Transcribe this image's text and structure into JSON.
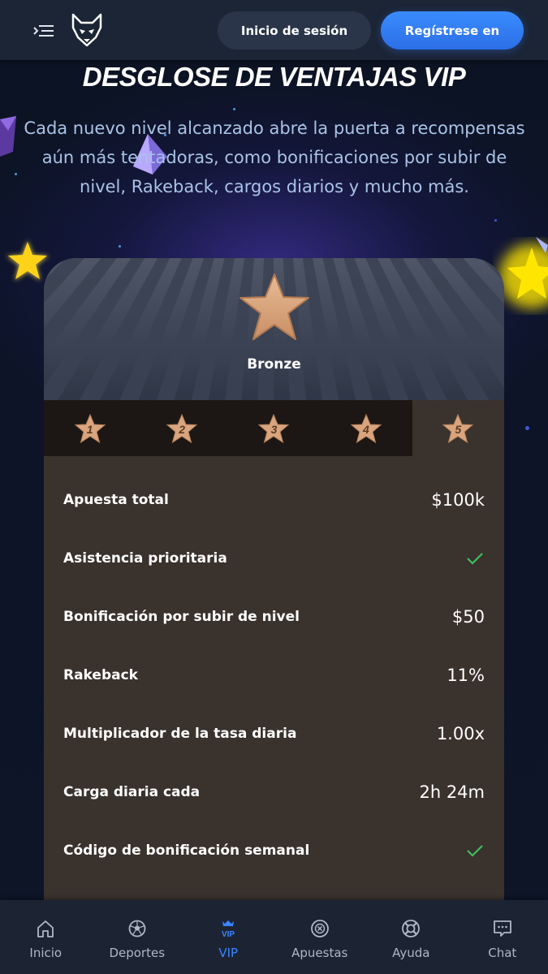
{
  "header": {
    "login_label": "Inicio de sesión",
    "register_label": "Regístrese en"
  },
  "hero": {
    "title": "DESGLOSE DE VENTAJAS VIP",
    "subtitle": "Cada nuevo nivel alcanzado abre la puerta a recompensas aún más tentadoras, como bonificaciones por subir de nivel, Rakeback, cargos diarios y mucho más."
  },
  "card": {
    "tier_name": "Bronze",
    "tier_color": "#d9a47e",
    "levels": [
      "1",
      "2",
      "3",
      "4",
      "5"
    ],
    "selected_level": "5",
    "rows": [
      {
        "label": "Apuesta total",
        "value": "$100k"
      },
      {
        "label": "Asistencia prioritaria",
        "value": "",
        "icon": "check-icon"
      },
      {
        "label": "Bonificación por subir de nivel",
        "value": "$50"
      },
      {
        "label": "Rakeback",
        "value": "11%"
      },
      {
        "label": "Multiplicador de la tasa diaria",
        "value": "1.00x"
      },
      {
        "label": "Carga diaria cada",
        "value": "2h 24m"
      },
      {
        "label": "Código de bonificación semanal",
        "value": "",
        "icon": "check-icon"
      }
    ]
  },
  "bottom_nav": {
    "items": [
      {
        "label": "Inicio",
        "icon": "home-icon"
      },
      {
        "label": "Deportes",
        "icon": "soccer-ball-icon"
      },
      {
        "label": "VIP",
        "icon": "vip-crown-icon",
        "active": true
      },
      {
        "label": "Apuestas",
        "icon": "chip-icon"
      },
      {
        "label": "Ayuda",
        "icon": "lifebuoy-icon"
      },
      {
        "label": "Chat",
        "icon": "chat-icon"
      }
    ]
  },
  "colors": {
    "accent": "#3a86ff",
    "check": "#3fbf5f",
    "card_bg": "#3a322d"
  }
}
